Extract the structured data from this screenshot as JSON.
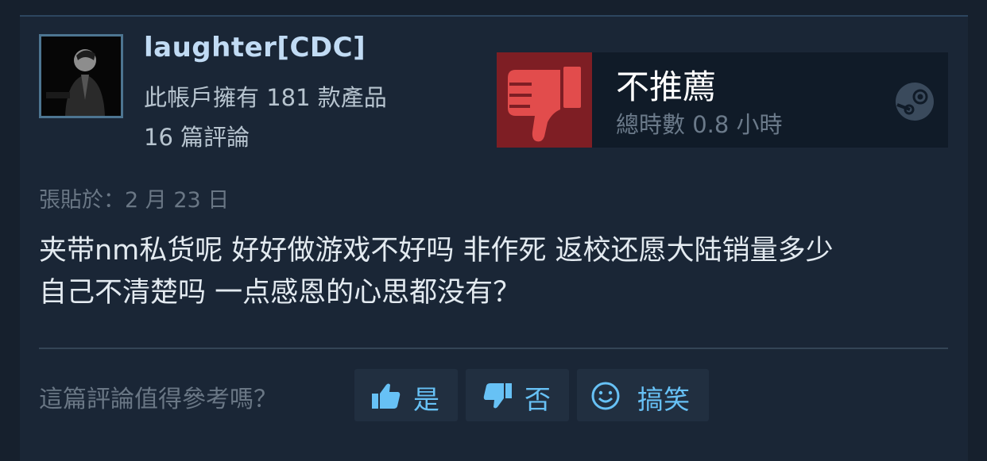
{
  "review": {
    "author": {
      "name": "laughter[CDC]",
      "games_owned": "此帳戶擁有 181 款產品",
      "review_count": "16 篇評論"
    },
    "verdict": {
      "label": "不推薦",
      "hours": "總時數 0.8 小時",
      "icon": "thumbs-down-icon",
      "accent": "#7e1e24"
    },
    "posted": "張貼於：2 月 23 日",
    "text_line1": "夹带nm私货呢 好好做游戏不好吗 非作死 返校还愿大陆销量多少",
    "text_line2": "自己不清楚吗 一点感恩的心思都没有？"
  },
  "helpful": {
    "question": "這篇評論值得參考嗎？",
    "yes_label": "是",
    "no_label": "否",
    "funny_label": "搞笑"
  },
  "colors": {
    "background": "#16202d",
    "accent_blue": "#67c1f5",
    "button_bg": "#212f40"
  }
}
